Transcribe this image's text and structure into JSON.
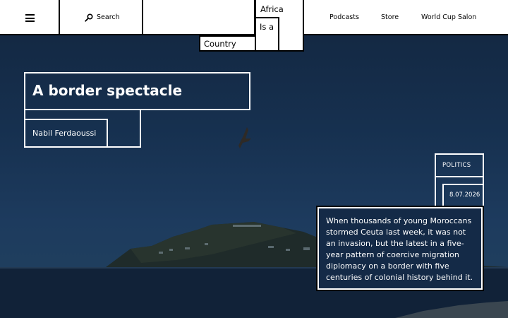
{
  "header": {
    "search_label": "Search",
    "nav": [
      "Podcasts",
      "Store",
      "World Cup Salon"
    ]
  },
  "logo": {
    "line1": "Africa",
    "line2": "Is a",
    "line3": "Country"
  },
  "article": {
    "title": "A border spectacle",
    "author": "Nabil Ferdaoussi",
    "category": "POLITICS",
    "date": "8.07.2026",
    "excerpt": "When thousands of young Moroccans stormed Ceuta last week, it was not an invasion, but the latest in a five-year pattern of coercive migration diplomacy on a border with five centuries of colonial history behind it."
  },
  "colors": {
    "overlay": "#142a47",
    "header_bg": "#ffffff",
    "ink": "#000000"
  },
  "icons": {
    "menu": "hamburger-icon",
    "search": "search-icon"
  }
}
